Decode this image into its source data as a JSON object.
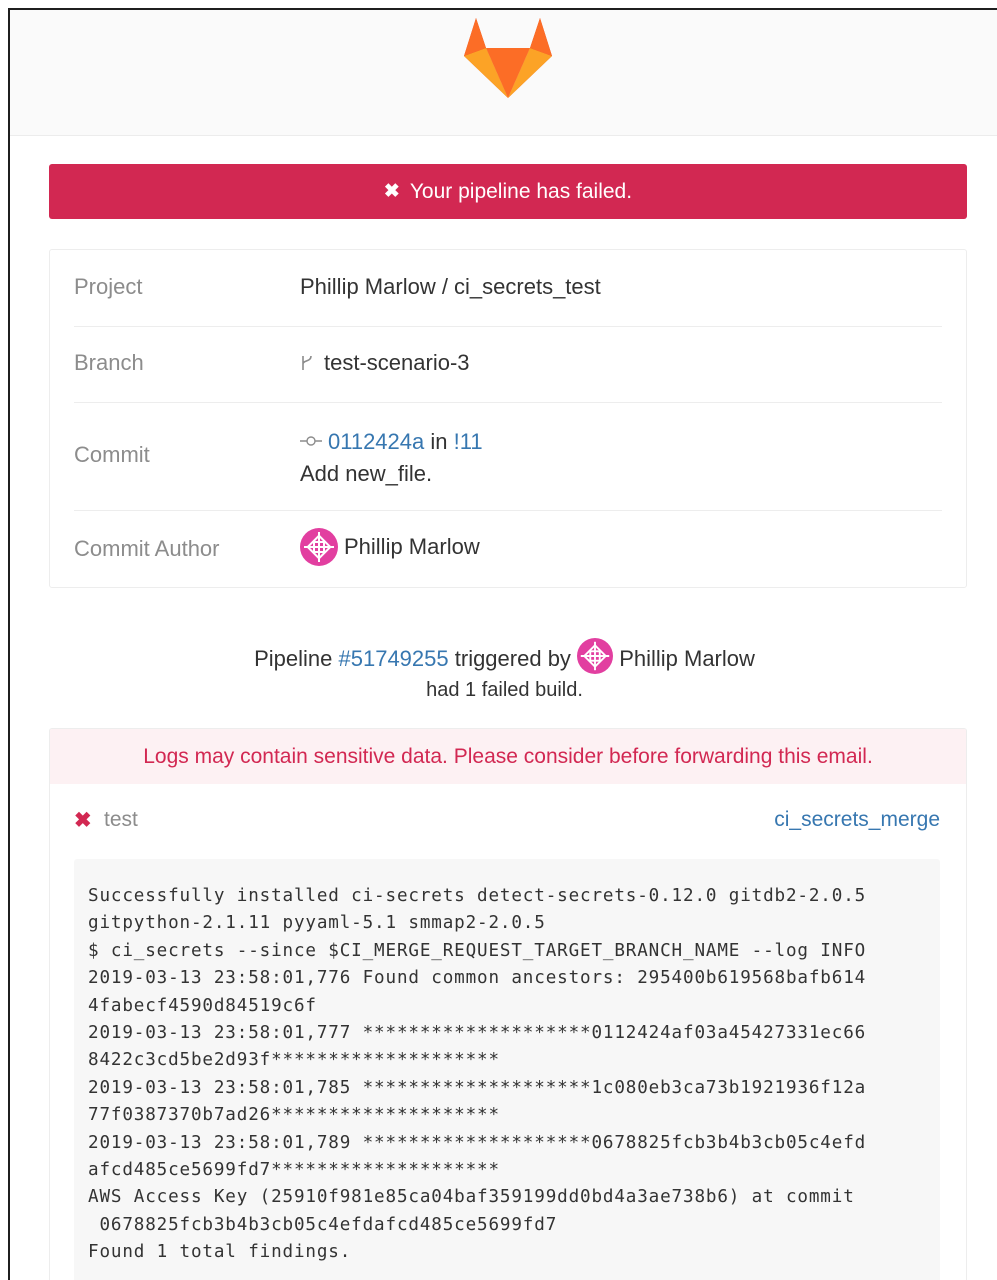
{
  "banner": {
    "icon": "✖",
    "text": "Your pipeline has failed."
  },
  "info": {
    "project": {
      "label": "Project",
      "value": "Phillip Marlow / ci_secrets_test"
    },
    "branch": {
      "label": "Branch",
      "icon": "branch-icon",
      "value": "test-scenario-3"
    },
    "commit": {
      "label": "Commit",
      "icon": "commit-icon",
      "sha": "0112424a",
      "in_text": "in",
      "mr": "!11",
      "message": "Add new_file."
    },
    "author": {
      "label": "Commit Author",
      "name": "Phillip Marlow"
    }
  },
  "pipeline": {
    "prefix": "Pipeline",
    "id": "#51749255",
    "triggered_by": "triggered by",
    "user": "Phillip Marlow",
    "summary": "had 1 failed build."
  },
  "logs": {
    "warning": "Logs may contain sensitive data. Please consider before forwarding this email.",
    "job": {
      "status_icon": "✖",
      "name": "test",
      "ref": "ci_secrets_merge"
    },
    "lines": [
      "Successfully installed ci-secrets detect-secrets-0.12.0 gitdb2-2.0.5",
      "gitpython-2.1.11 pyyaml-5.1 smmap2-2.0.5",
      "$ ci_secrets --since $CI_MERGE_REQUEST_TARGET_BRANCH_NAME --log INFO",
      "2019-03-13 23:58:01,776 Found common ancestors: 295400b619568bafb614",
      "4fabecf4590d84519c6f",
      "2019-03-13 23:58:01,777 ********************0112424af03a45427331ec66",
      "8422c3cd5be2d93f********************",
      "2019-03-13 23:58:01,785 ********************1c080eb3ca73b1921936f12a",
      "77f0387370b7ad26********************",
      "2019-03-13 23:58:01,789 ********************0678825fcb3b4b3cb05c4efd",
      "afcd485ce5699fd7********************",
      "AWS Access Key (25910f981e85ca04baf359199dd0bd4a3ae738b6) at commit",
      " 0678825fcb3b4b3cb05c4efdafcd485ce5699fd7",
      "Found 1 total findings."
    ]
  },
  "colors": {
    "danger": "#d22852",
    "link": "#3777b0",
    "muted": "#8c8c8c",
    "warn_bg": "#fdf1f3"
  }
}
